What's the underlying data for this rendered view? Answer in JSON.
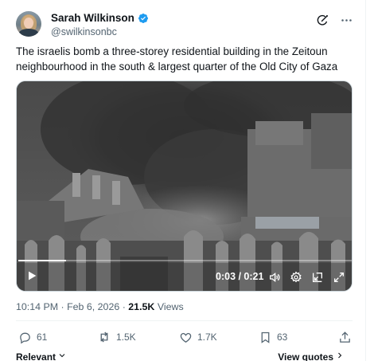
{
  "author": {
    "display_name": "Sarah Wilkinson",
    "handle": "@swilkinsonbc",
    "verified": true
  },
  "header_icons": [
    "grok-icon",
    "more-icon"
  ],
  "tweet": {
    "text": "The israelis bomb a three-storey residential building in the Zeitoun neighbourhood in the south & largest quarter of the Old City of Gaza"
  },
  "video": {
    "time_display": "0:03 / 0:21",
    "progress_fraction": 0.143,
    "controls": [
      "play-icon",
      "volume-icon",
      "settings-icon",
      "picture-in-picture-icon",
      "fullscreen-icon"
    ]
  },
  "meta": {
    "time": "10:14 PM",
    "separator": "·",
    "date": "Feb 6, 2026",
    "views_count": "21.5K",
    "views_label": "Views"
  },
  "actions": {
    "replies": "61",
    "reposts": "1.5K",
    "likes": "1.7K",
    "bookmarks": "63"
  },
  "footer": {
    "left_label": "Relevant",
    "right_label": "View quotes"
  },
  "colors": {
    "text": "#0f1419",
    "secondary": "#536471",
    "verified": "#1d9bf0",
    "border": "#eff3f4"
  }
}
